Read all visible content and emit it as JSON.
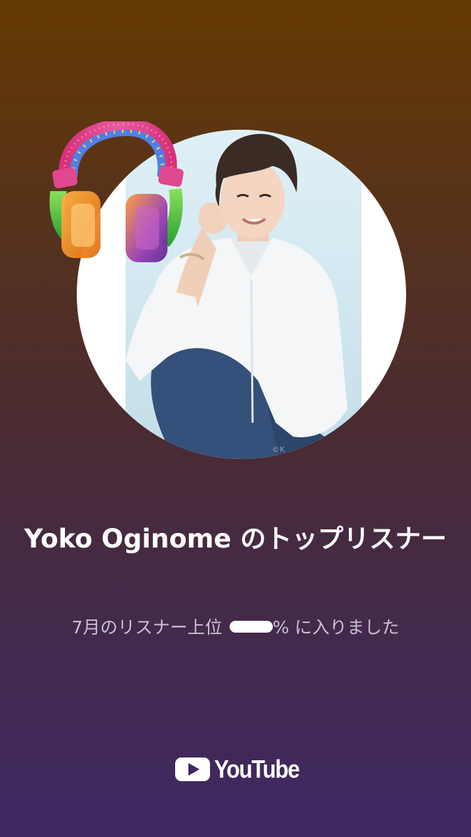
{
  "artist": {
    "name": "Yoko Oginome",
    "title": "Yoko Oginome のトップリスナー"
  },
  "stat": {
    "prefix": "7月のリスナー上位",
    "suffix": "% に入りました",
    "value_hidden": true
  },
  "brand": {
    "name": "YouTube",
    "accent": "#ffffff"
  },
  "photo": {
    "credit": "©K"
  },
  "icons": {
    "decoration": "headphones-icon",
    "logo": "youtube-play-icon"
  },
  "colors": {
    "background_top": "#653a03",
    "background_bottom": "#3e2863",
    "title": "#ffffff",
    "subtitle": "#c9c2cf"
  }
}
